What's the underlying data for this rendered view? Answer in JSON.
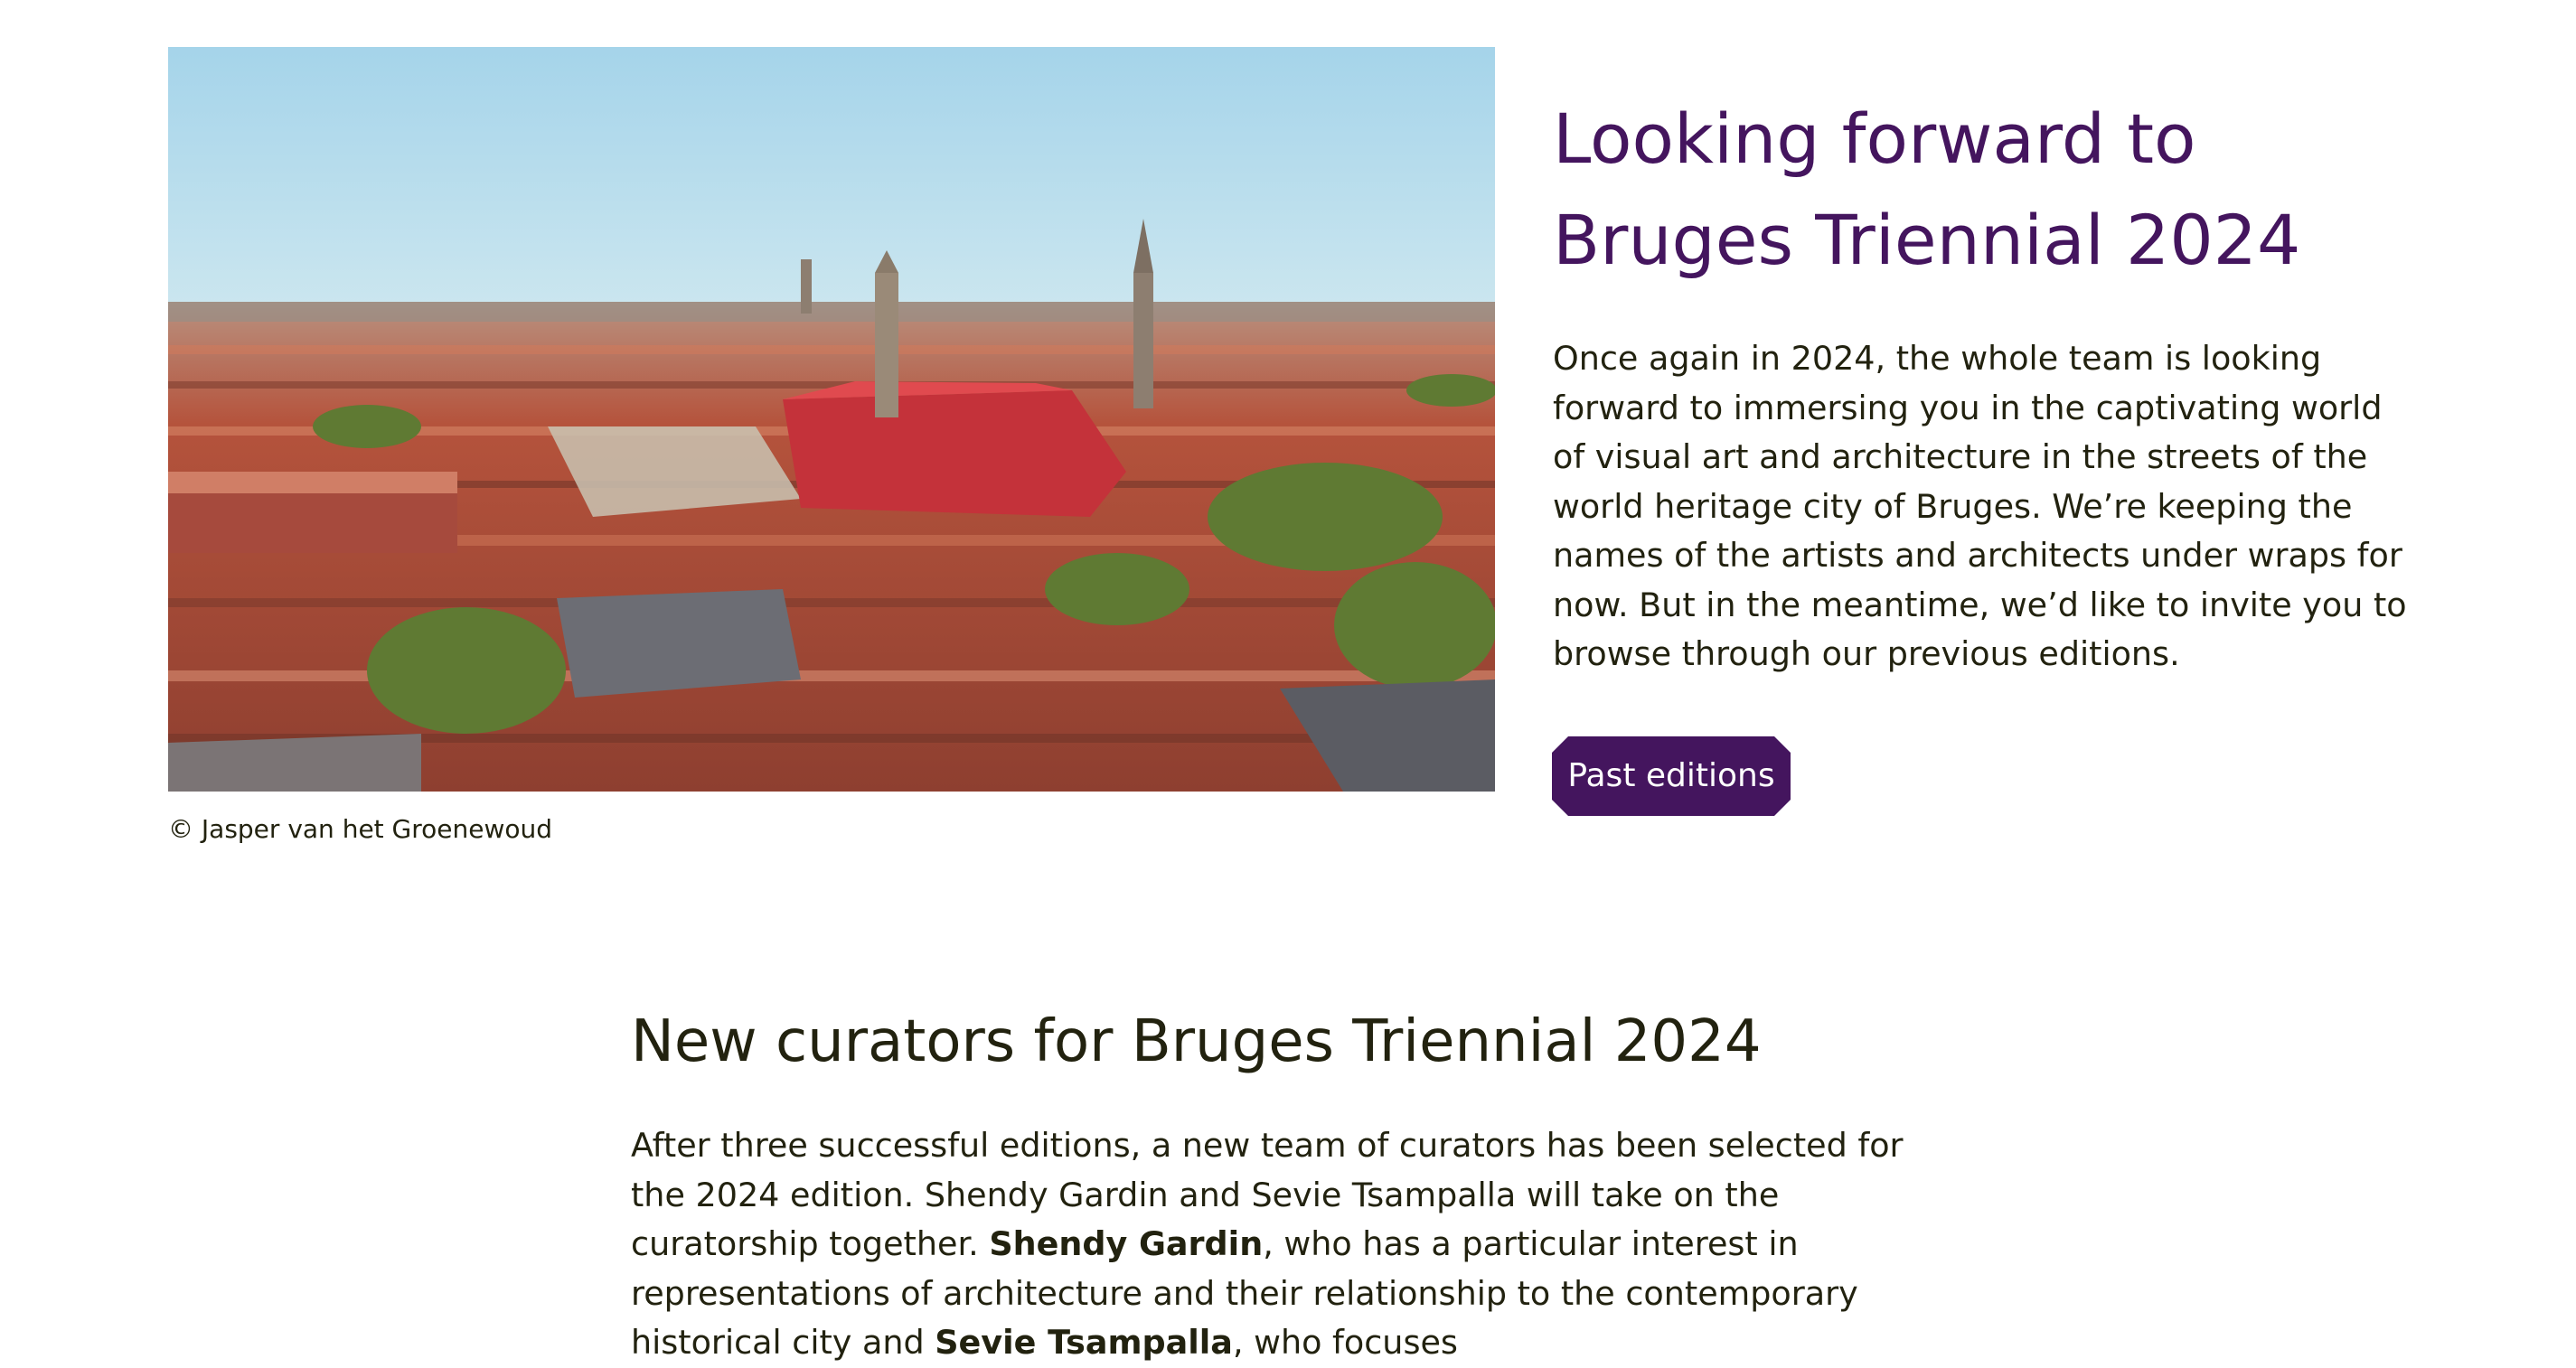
{
  "hero": {
    "image_alt": "Aerial view of Bruges",
    "credit": "© Jasper van het Groenewoud",
    "title": "Looking forward to Bruges Triennial 2024",
    "text": "Once again in 2024, the whole team is looking forward to immersing you in the captivating world of visual art and architecture in the streets of the world heritage city of Bruges. We’re keeping the names of the artists and architects under wraps for now. But in the meantime, we’d like to invite you to browse through our previous editions.",
    "button_label": "Past editions"
  },
  "curators": {
    "title": "New curators for Bruges Triennial 2024",
    "intro": "After three successful editions, a new team of curators has been selected for the 2024 edition. Shendy Gardin and Sevie Tsampalla will take on the curatorship together.",
    "curator1_name": "Shendy Gardin",
    "curator1_text": ", who has a particular interest in representations of architecture and their relationship to the contemporary historical city and ",
    "curator2_name": "Sevie Tsampalla",
    "curator2_text": ", who focuses"
  },
  "colors": {
    "accent": "#44155e",
    "text": "#22220f",
    "background": "#ffffff"
  }
}
